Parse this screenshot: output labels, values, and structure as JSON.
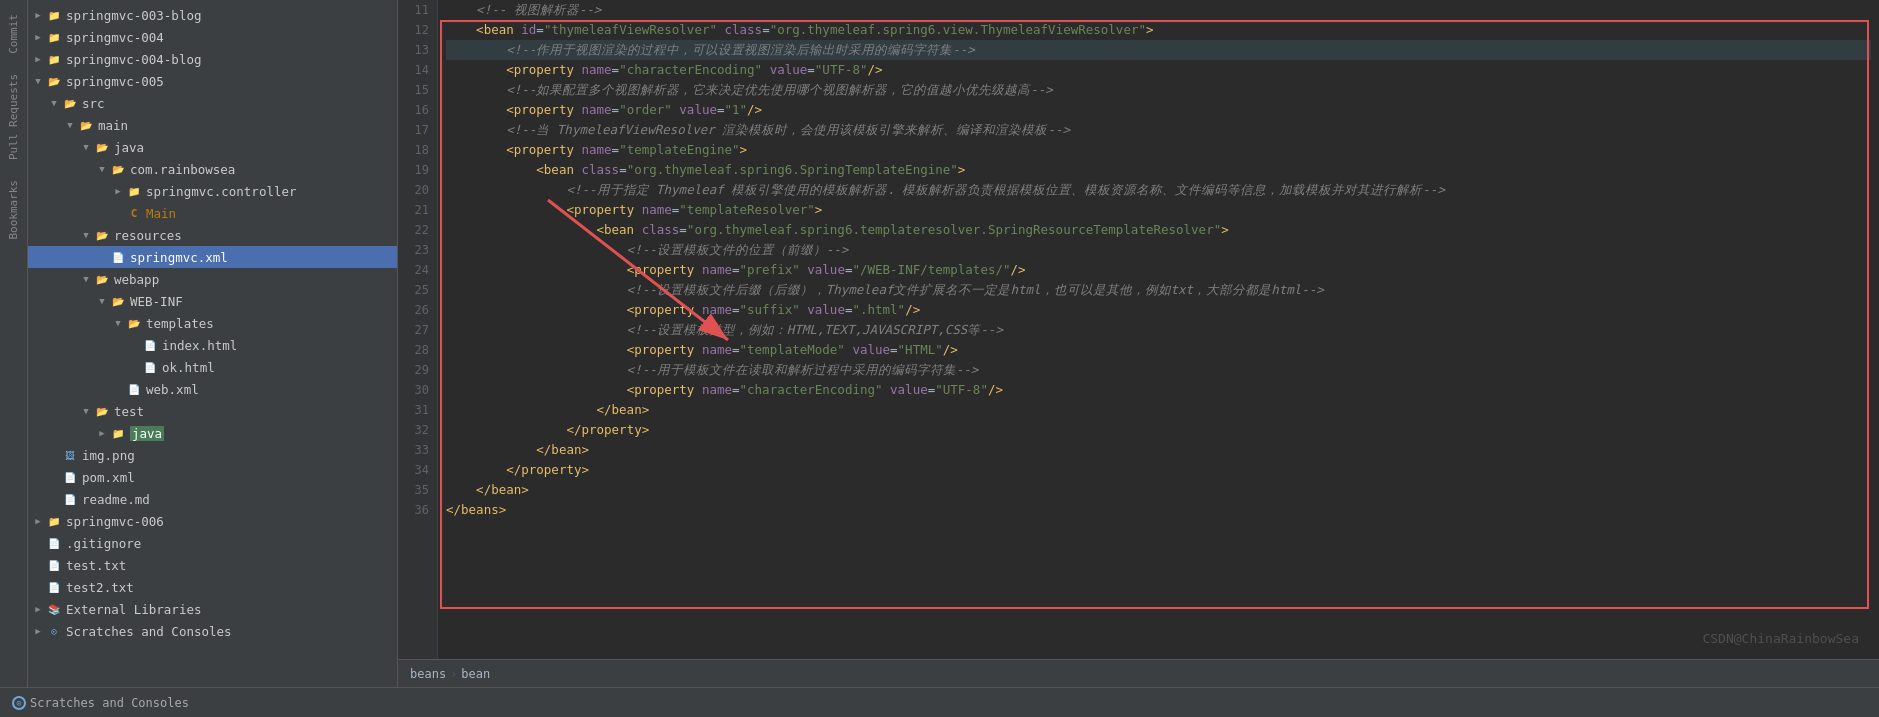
{
  "sidebar": {
    "items": [
      {
        "id": "springmvc-003",
        "label": "springmvc-003-blog",
        "indent": 0,
        "type": "folder",
        "expanded": false
      },
      {
        "id": "springmvc-004",
        "label": "springmvc-004",
        "indent": 0,
        "type": "folder",
        "expanded": false
      },
      {
        "id": "springmvc-004-blog",
        "label": "springmvc-004-blog",
        "indent": 0,
        "type": "folder",
        "expanded": false
      },
      {
        "id": "springmvc-005",
        "label": "springmvc-005",
        "indent": 0,
        "type": "folder",
        "expanded": true
      },
      {
        "id": "src",
        "label": "src",
        "indent": 1,
        "type": "folder",
        "expanded": true
      },
      {
        "id": "main",
        "label": "main",
        "indent": 2,
        "type": "folder",
        "expanded": true
      },
      {
        "id": "java",
        "label": "java",
        "indent": 3,
        "type": "folder",
        "expanded": true
      },
      {
        "id": "com-rainbowsea",
        "label": "com.rainbowsea",
        "indent": 4,
        "type": "folder",
        "expanded": true
      },
      {
        "id": "springmvc-controller",
        "label": "springmvc.controller",
        "indent": 5,
        "type": "folder",
        "expanded": false
      },
      {
        "id": "main-class",
        "label": "Main",
        "indent": 5,
        "type": "java",
        "expanded": false
      },
      {
        "id": "resources",
        "label": "resources",
        "indent": 3,
        "type": "folder",
        "expanded": true
      },
      {
        "id": "springmvc-xml",
        "label": "springmvc.xml",
        "indent": 4,
        "type": "xml",
        "expanded": false,
        "selected": true
      },
      {
        "id": "webapp",
        "label": "webapp",
        "indent": 3,
        "type": "folder",
        "expanded": true
      },
      {
        "id": "web-inf",
        "label": "WEB-INF",
        "indent": 4,
        "type": "folder",
        "expanded": true
      },
      {
        "id": "templates",
        "label": "templates",
        "indent": 5,
        "type": "folder",
        "expanded": true
      },
      {
        "id": "index-html",
        "label": "index.html",
        "indent": 6,
        "type": "html",
        "expanded": false
      },
      {
        "id": "ok-html",
        "label": "ok.html",
        "indent": 6,
        "type": "html",
        "expanded": false
      },
      {
        "id": "web-xml",
        "label": "web.xml",
        "indent": 5,
        "type": "xml",
        "expanded": false
      },
      {
        "id": "test",
        "label": "test",
        "indent": 3,
        "type": "folder",
        "expanded": true
      },
      {
        "id": "test-java",
        "label": "java",
        "indent": 4,
        "type": "folder",
        "expanded": false
      },
      {
        "id": "img-png",
        "label": "img.png",
        "indent": 1,
        "type": "img",
        "expanded": false
      },
      {
        "id": "pom-xml",
        "label": "pom.xml",
        "indent": 1,
        "type": "xml",
        "expanded": false
      },
      {
        "id": "readme-md",
        "label": "readme.md",
        "indent": 1,
        "type": "md",
        "expanded": false
      },
      {
        "id": "springmvc-006",
        "label": "springmvc-006",
        "indent": 0,
        "type": "folder",
        "expanded": false
      },
      {
        "id": "gitignore",
        "label": ".gitignore",
        "indent": 0,
        "type": "git",
        "expanded": false
      },
      {
        "id": "test-txt",
        "label": "test.txt",
        "indent": 0,
        "type": "txt",
        "expanded": false
      },
      {
        "id": "test2-txt",
        "label": "test2.txt",
        "indent": 0,
        "type": "txt",
        "expanded": false
      },
      {
        "id": "external-libs",
        "label": "External Libraries",
        "indent": 0,
        "type": "folder",
        "expanded": false
      },
      {
        "id": "scratches",
        "label": "Scratches and Consoles",
        "indent": 0,
        "type": "console",
        "expanded": false
      }
    ]
  },
  "side_panel": {
    "items": [
      "Commit",
      "Pull Requests",
      "Bookmarks"
    ]
  },
  "editor": {
    "lines": [
      {
        "num": 11,
        "content": "    <!-- 视图解析器-->",
        "type": "comment"
      },
      {
        "num": 12,
        "content": "    <bean id=\"thymeleafViewResolver\" class=\"org.thymeleaf.spring6.view.ThymeleafViewResolver\">",
        "type": "code"
      },
      {
        "num": 13,
        "content": "        <!--作用于视图渲染的过程中，可以设置视图渲染后输出时采用的编码字符集-->",
        "type": "comment",
        "highlight": true
      },
      {
        "num": 14,
        "content": "        <property name=\"characterEncoding\" value=\"UTF-8\"/>",
        "type": "code"
      },
      {
        "num": 15,
        "content": "        <!--如果配置多个视图解析器，它来决定优先使用哪个视图解析器，它的值越小优先级越高-->",
        "type": "comment"
      },
      {
        "num": 16,
        "content": "        <property name=\"order\" value=\"1\"/>",
        "type": "code"
      },
      {
        "num": 17,
        "content": "        <!--当 ThymeleafViewResolver 渲染模板时，会使用该模板引擎来解析、编译和渲染模板-->",
        "type": "comment"
      },
      {
        "num": 18,
        "content": "        <property name=\"templateEngine\">",
        "type": "code"
      },
      {
        "num": 19,
        "content": "            <bean class=\"org.thymeleaf.spring6.SpringTemplateEngine\">",
        "type": "code"
      },
      {
        "num": 20,
        "content": "                <!--用于指定 Thymeleaf 模板引擎使用的模板解析器. 模板解析器负责根据模板位置、模板资源名称、文件编码等信息，加载模板并对其进行解析-->",
        "type": "comment"
      },
      {
        "num": 21,
        "content": "                <property name=\"templateResolver\">",
        "type": "code"
      },
      {
        "num": 22,
        "content": "                    <bean class=\"org.thymeleaf.spring6.templateresolver.SpringResourceTemplateResolver\">",
        "type": "code"
      },
      {
        "num": 23,
        "content": "                        <!--设置模板文件的位置（前缀）-->",
        "type": "comment"
      },
      {
        "num": 24,
        "content": "                        <property name=\"prefix\" value=\"/WEB-INF/templates/\"/>",
        "type": "code"
      },
      {
        "num": 25,
        "content": "                        <!--设置模板文件后缀（后缀），Thymeleaf文件扩展名不一定是html，也可以是其他，例如txt，大部分都是html-->",
        "type": "comment"
      },
      {
        "num": 26,
        "content": "                        <property name=\"suffix\" value=\".html\"/>",
        "type": "code"
      },
      {
        "num": 27,
        "content": "                        <!--设置模板类型，例如：HTML,TEXT,JAVASCRIPT,CSS等-->",
        "type": "comment"
      },
      {
        "num": 28,
        "content": "                        <property name=\"templateMode\" value=\"HTML\"/>",
        "type": "code"
      },
      {
        "num": 29,
        "content": "                        <!--用于模板文件在读取和解析过程中采用的编码字符集-->",
        "type": "comment"
      },
      {
        "num": 30,
        "content": "                        <property name=\"characterEncoding\" value=\"UTF-8\"/>",
        "type": "code"
      },
      {
        "num": 31,
        "content": "                    </bean>",
        "type": "code"
      },
      {
        "num": 32,
        "content": "                </property>",
        "type": "code"
      },
      {
        "num": 33,
        "content": "            </bean>",
        "type": "code"
      },
      {
        "num": 34,
        "content": "        </property>",
        "type": "code"
      },
      {
        "num": 35,
        "content": "    </bean>",
        "type": "code"
      },
      {
        "num": 36,
        "content": "</beans>",
        "type": "code"
      }
    ]
  },
  "breadcrumb": {
    "items": [
      "beans",
      "bean"
    ]
  },
  "bottom_bar": {
    "scratches_label": "Scratches and Consoles",
    "bean_label": "bean",
    "watermark": "CSDN@ChinaRainbowSea"
  }
}
